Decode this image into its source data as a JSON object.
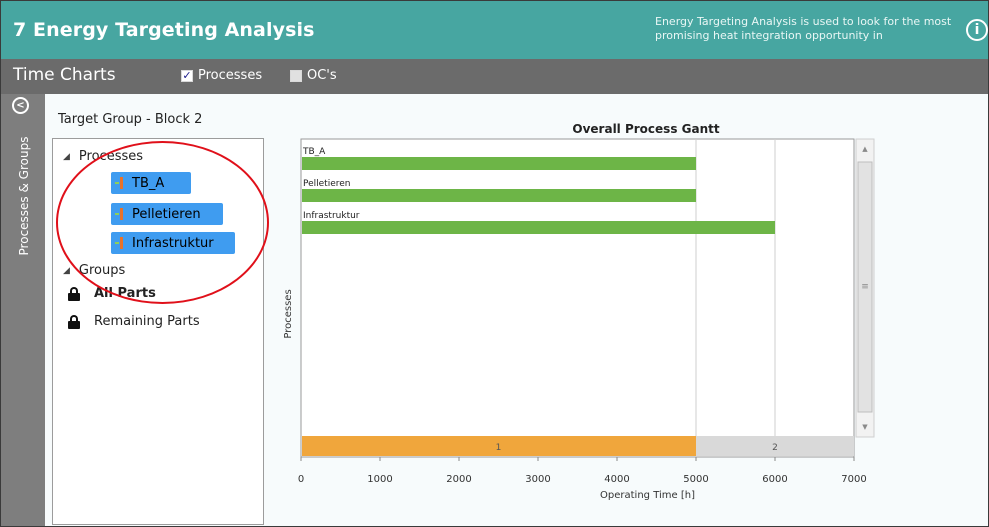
{
  "window": {
    "title": "7 Energy Targeting Analysis",
    "description": "Energy Targeting Analysis is used to look for the most promising heat integration opportunity in",
    "info_icon": "i"
  },
  "toolbar": {
    "subtitle": "Time Charts",
    "processes_checkbox": {
      "label": "Processes",
      "checked": true
    },
    "ocs_checkbox": {
      "label": "OC's",
      "checked": false
    }
  },
  "rail": {
    "label": "Processes & Groups",
    "collapse_icon": "chevron-left-icon"
  },
  "target": {
    "title": "Target Group - Block 2",
    "tree": {
      "processes_label": "Processes",
      "processes": [
        "TB_A",
        "Pelletieren",
        "Infrastruktur"
      ],
      "groups_label": "Groups",
      "groups": [
        {
          "label": "All Parts",
          "bold": true
        },
        {
          "label": "Remaining Parts",
          "bold": false
        }
      ]
    }
  },
  "colors": {
    "titlebar": "#47a6a1",
    "subbar": "#6b6b6b",
    "bar_green": "#6db547",
    "period_orange": "#f0a63c",
    "period_gray": "#d9d9d9",
    "selection": "#3f9cf0",
    "annotation": "#e0101a"
  },
  "chart_data": {
    "type": "bar",
    "title": "Overall Process Gantt",
    "xlabel": "Operating Time [h]",
    "ylabel": "Processes",
    "xlim": [
      0,
      7000
    ],
    "xticks": [
      0,
      1000,
      2000,
      3000,
      4000,
      5000,
      6000,
      7000
    ],
    "categories": [
      "TB_A",
      "Pelletieren",
      "Infrastruktur"
    ],
    "values": [
      5000,
      5000,
      6000
    ],
    "periods": [
      {
        "label": "1",
        "start": 0,
        "end": 5000
      },
      {
        "label": "2",
        "start": 5000,
        "end": 7000
      }
    ],
    "gridlines_at": [
      5000,
      6000
    ]
  }
}
